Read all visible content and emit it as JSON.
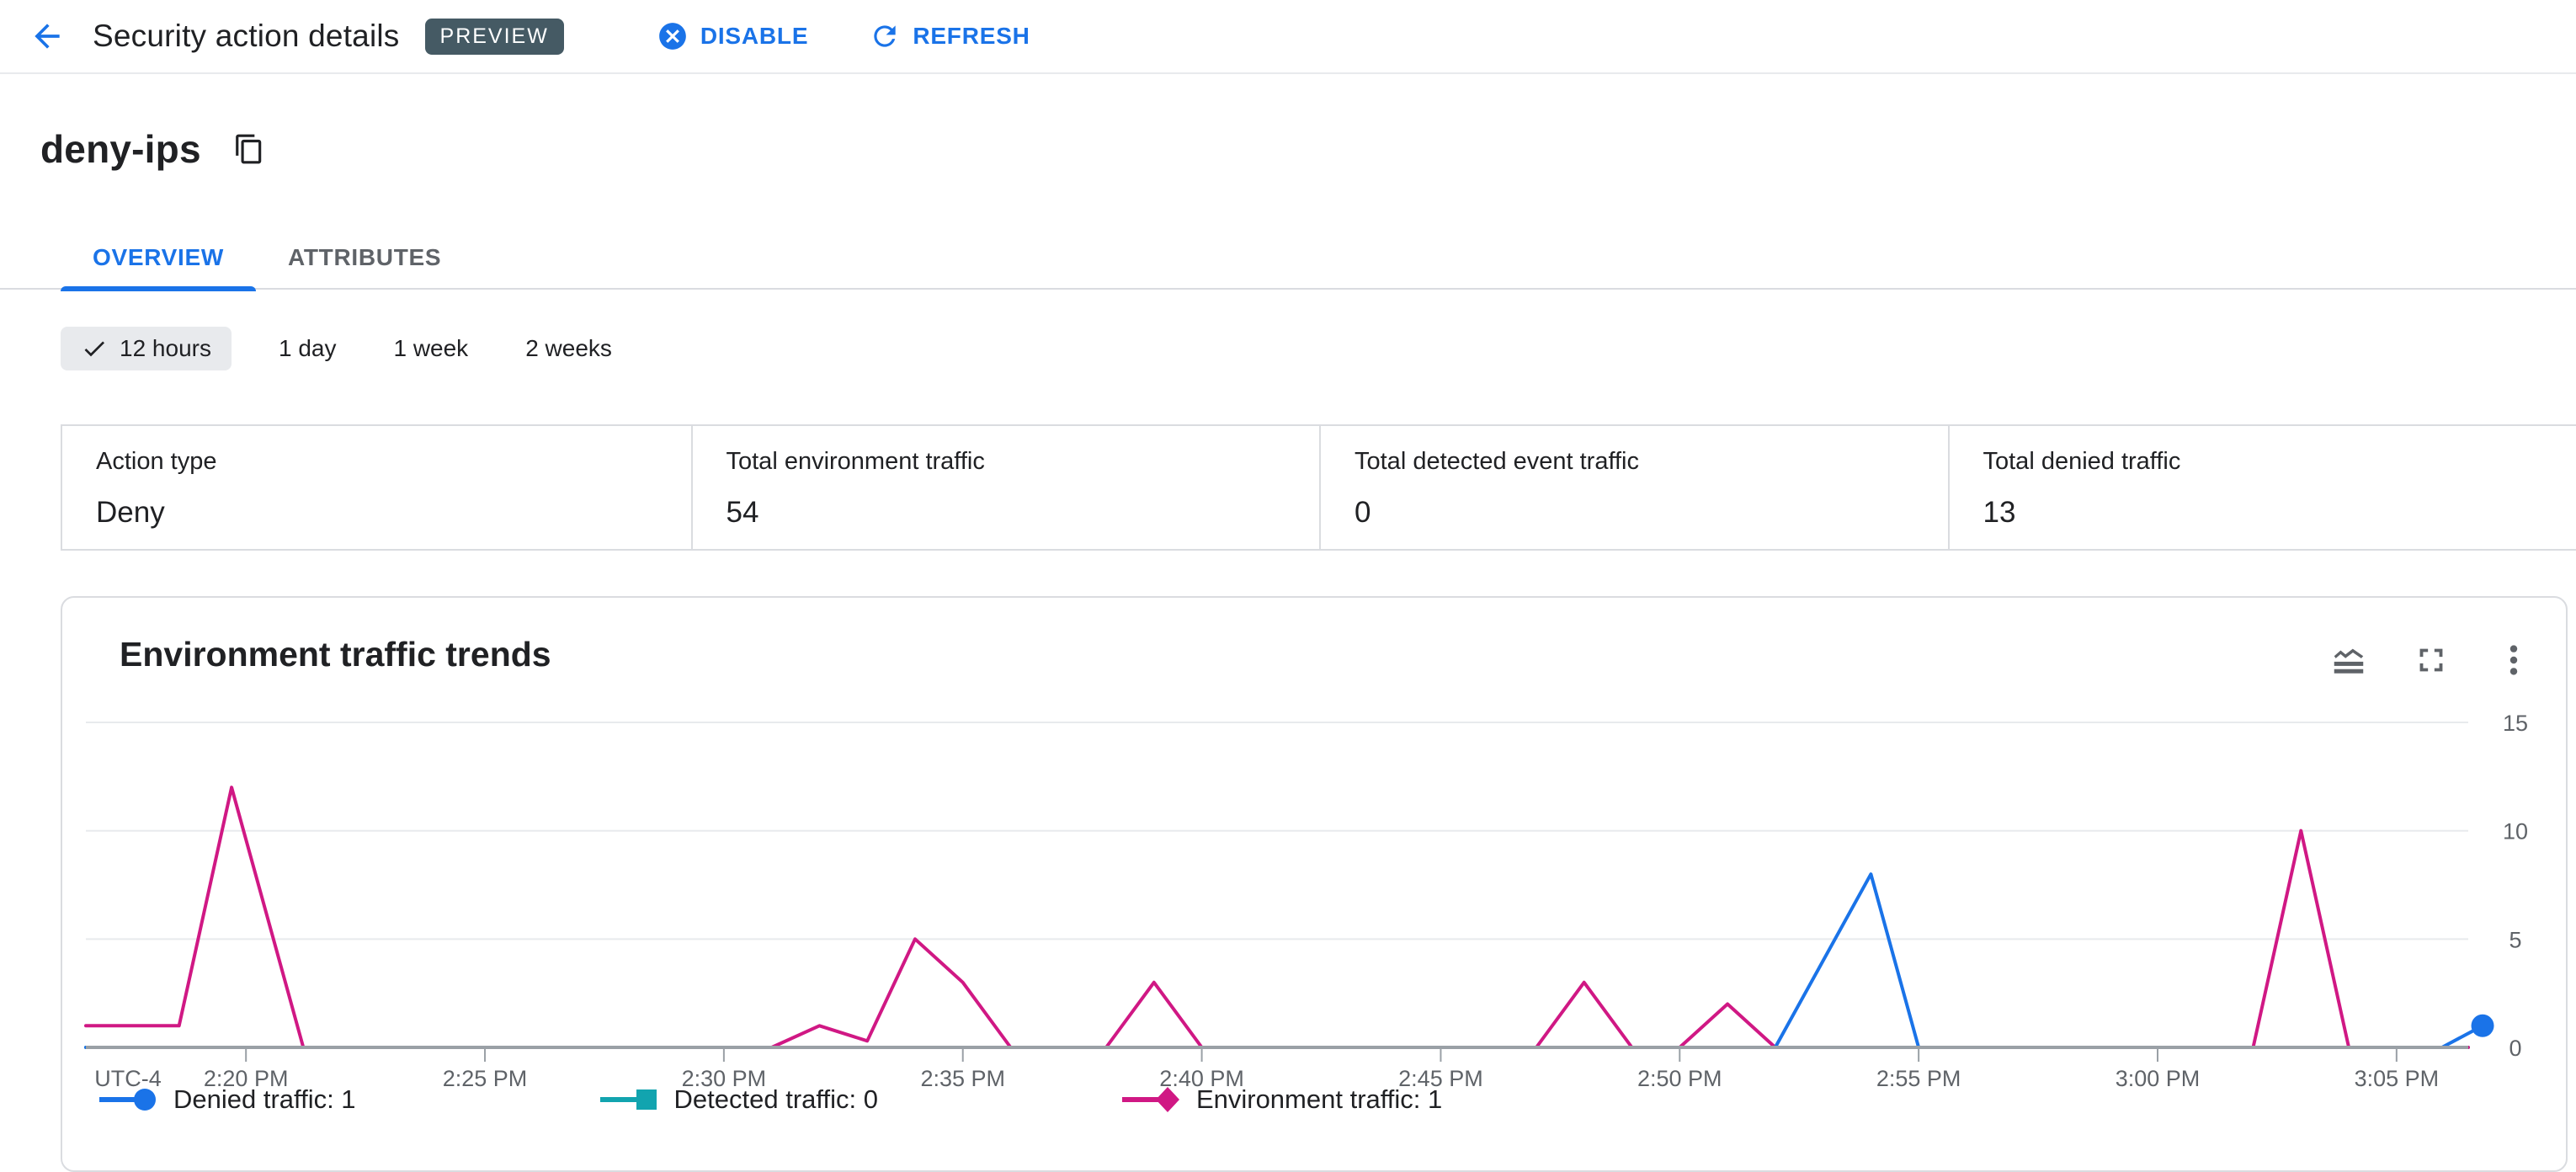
{
  "header": {
    "title": "Security action details",
    "preview_badge": "PREVIEW",
    "disable_label": "DISABLE",
    "refresh_label": "REFRESH"
  },
  "page": {
    "action_name": "deny-ips"
  },
  "tabs": [
    {
      "label": "OVERVIEW",
      "active": true
    },
    {
      "label": "ATTRIBUTES",
      "active": false
    }
  ],
  "time_ranges": {
    "selected": "12 hours",
    "options": [
      "12 hours",
      "1 day",
      "1 week",
      "2 weeks"
    ]
  },
  "stats": [
    {
      "label": "Action type",
      "value": "Deny"
    },
    {
      "label": "Total environment traffic",
      "value": "54"
    },
    {
      "label": "Total detected event traffic",
      "value": "0"
    },
    {
      "label": "Total denied traffic",
      "value": "13"
    }
  ],
  "chart": {
    "title": "Environment traffic trends",
    "icons": [
      "legend-toggle-icon",
      "fullscreen-icon",
      "more-vert-icon"
    ]
  },
  "legend": [
    {
      "label": "Denied traffic: 1",
      "marker": "circle",
      "color": "#1a73e8"
    },
    {
      "label": "Detected traffic: 0",
      "marker": "square",
      "color": "#12a4af"
    },
    {
      "label": "Environment traffic: 1",
      "marker": "diamond",
      "color": "#d01884"
    }
  ],
  "chart_data": {
    "type": "line",
    "title": "Environment traffic trends",
    "timezone_label": "UTC-4",
    "x_axis": {
      "unit": "minutes from left edge (~2:17 PM)",
      "domain": [
        0,
        49.85
      ],
      "ticks": [
        {
          "u": 3.35,
          "label": "2:20 PM"
        },
        {
          "u": 8.35,
          "label": "2:25 PM"
        },
        {
          "u": 13.35,
          "label": "2:30 PM"
        },
        {
          "u": 18.35,
          "label": "2:35 PM"
        },
        {
          "u": 23.35,
          "label": "2:40 PM"
        },
        {
          "u": 28.35,
          "label": "2:45 PM"
        },
        {
          "u": 33.35,
          "label": "2:50 PM"
        },
        {
          "u": 38.35,
          "label": "2:55 PM"
        },
        {
          "u": 43.35,
          "label": "3:00 PM"
        },
        {
          "u": 48.35,
          "label": "3:05 PM"
        }
      ]
    },
    "y_axis": {
      "ticks": [
        0,
        5,
        10,
        15
      ],
      "range": [
        0,
        15.6
      ],
      "position": "right",
      "grid": true
    },
    "series": [
      {
        "name": "Detected traffic",
        "color": "#12a4af",
        "marker": "square",
        "legend_value": 0,
        "points": [
          [
            0,
            0
          ],
          [
            49.85,
            0
          ]
        ]
      },
      {
        "name": "Environment traffic",
        "color": "#d01884",
        "marker": "diamond",
        "legend_value": 1,
        "points": [
          [
            0,
            1
          ],
          [
            1.95,
            1
          ],
          [
            3.05,
            12
          ],
          [
            4.55,
            0
          ],
          [
            14.35,
            0
          ],
          [
            15.35,
            1
          ],
          [
            16.35,
            0.3
          ],
          [
            17.35,
            5
          ],
          [
            18.35,
            3
          ],
          [
            19.35,
            0
          ],
          [
            21.35,
            0
          ],
          [
            22.35,
            3
          ],
          [
            23.35,
            0
          ],
          [
            30.35,
            0
          ],
          [
            31.35,
            3
          ],
          [
            32.35,
            0
          ],
          [
            33.35,
            0
          ],
          [
            34.35,
            2
          ],
          [
            35.35,
            0
          ],
          [
            45.35,
            0
          ],
          [
            46.35,
            10
          ],
          [
            47.35,
            0
          ],
          [
            49.85,
            0
          ]
        ]
      },
      {
        "name": "Denied traffic",
        "color": "#1a73e8",
        "marker": "circle",
        "legend_value": 1,
        "points": [
          [
            0,
            0
          ],
          [
            35.35,
            0
          ],
          [
            37.35,
            8
          ],
          [
            38.35,
            0
          ],
          [
            49.3,
            0
          ],
          [
            50.15,
            1
          ]
        ],
        "end_dot": {
          "u": 50.15,
          "v": 1
        }
      }
    ],
    "colors": {
      "axis": "#9aa0a6",
      "gridline": "#e8eaed",
      "tick_text": "#5f6368"
    }
  }
}
